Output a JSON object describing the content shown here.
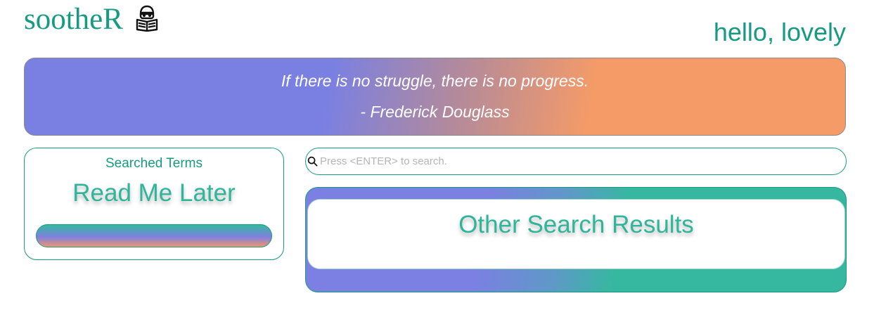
{
  "header": {
    "logo_text": "sootheR",
    "logo_icon": "reading-person-icon",
    "greeting": "hello, lovely"
  },
  "quote": {
    "text": "If there is no struggle, there is no progress.",
    "author": "- Frederick Douglass"
  },
  "terms_panel": {
    "title": "Searched Terms",
    "heading": "Read Me Later"
  },
  "search": {
    "icon": "search-icon",
    "placeholder": "Press <ENTER> to search.",
    "value": ""
  },
  "results": {
    "heading": "Other Search Results"
  },
  "colors": {
    "brand": "#169b82",
    "accent_teal": "#36b8a0",
    "accent_purple": "#7a80e2",
    "accent_orange": "#f59b68"
  }
}
